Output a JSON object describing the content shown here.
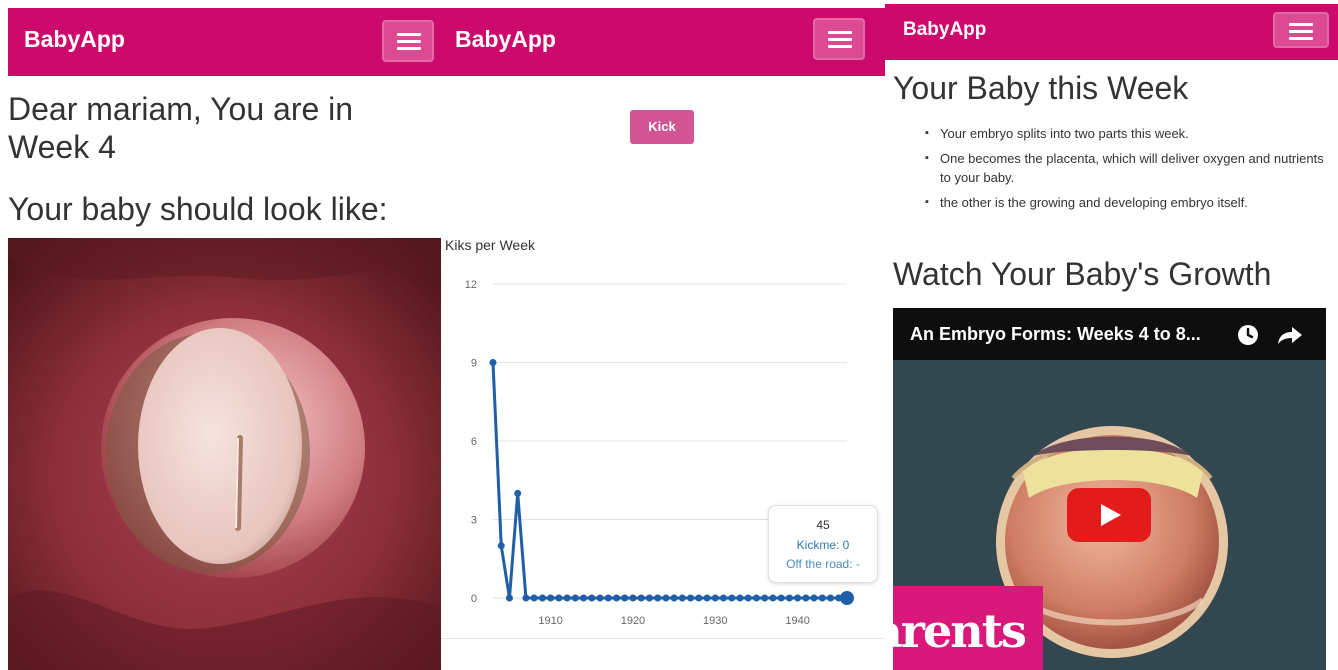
{
  "app": {
    "brand": "BabyApp"
  },
  "colors": {
    "primary": "#cc0a6b",
    "kick_button": "#d45593",
    "series": "#1f5fa6",
    "play_button": "#e21b1b"
  },
  "screen1": {
    "greeting": "Dear mariam, You are in Week 4",
    "look_heading": "Your baby should look like:",
    "image_subject": "week-4 embryo photograph"
  },
  "screen2": {
    "kick_button": "Kick",
    "chart_data": {
      "type": "line",
      "title": "Kiks per Week",
      "xlabel": "",
      "ylabel": "",
      "ylim": [
        0,
        12
      ],
      "xlim": [
        1903,
        1946
      ],
      "yticks": [
        "0",
        "3",
        "6",
        "9",
        "12"
      ],
      "xticks": [
        "1910",
        "1920",
        "1930",
        "1940"
      ],
      "grid": true,
      "series": [
        {
          "name": "Kickme",
          "x": [
            1903,
            1904,
            1905,
            1906,
            1907,
            1908,
            1909,
            1910,
            1911,
            1912,
            1913,
            1914,
            1915,
            1916,
            1917,
            1918,
            1919,
            1920,
            1921,
            1922,
            1923,
            1924,
            1925,
            1926,
            1927,
            1928,
            1929,
            1930,
            1931,
            1932,
            1933,
            1934,
            1935,
            1936,
            1937,
            1938,
            1939,
            1940,
            1941,
            1942,
            1943,
            1944,
            1945,
            1946
          ],
          "values": [
            9,
            2,
            0,
            4,
            0,
            0,
            0,
            0,
            0,
            0,
            0,
            0,
            0,
            0,
            0,
            0,
            0,
            0,
            0,
            0,
            0,
            0,
            0,
            0,
            0,
            0,
            0,
            0,
            0,
            0,
            0,
            0,
            0,
            0,
            0,
            0,
            0,
            0,
            0,
            0,
            0,
            0,
            0,
            0
          ]
        }
      ],
      "tooltip": {
        "title": "45",
        "line1": "Kickme: 0",
        "line2": "Off the road: -"
      }
    }
  },
  "screen3": {
    "week_heading": "Your Baby this Week",
    "bullets": [
      "Your embryo splits into two parts this week.",
      "One becomes the placenta, which will deliver oxygen and nutrients to your baby.",
      "the other is the growing and developing embryo itself."
    ],
    "growth_heading": "Watch Your Baby's Growth",
    "video": {
      "title": "An Embryo Forms: Weeks 4 to 8...",
      "watch_later_icon": "clock-icon",
      "share_icon": "share-icon",
      "play_icon": "play-icon",
      "overlay_text": "arents"
    }
  }
}
